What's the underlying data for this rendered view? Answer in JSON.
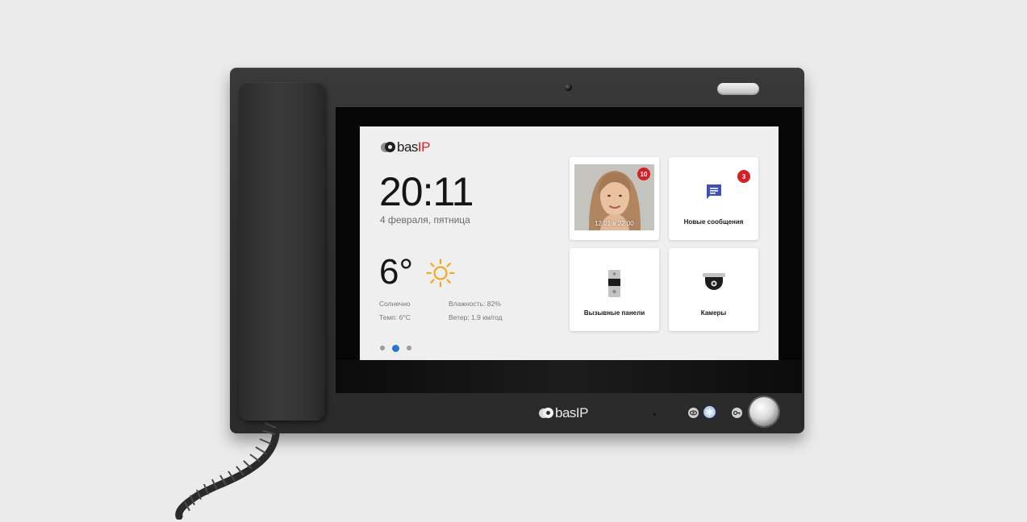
{
  "screen": {
    "logo": {
      "text": "bas",
      "accent": "IP"
    },
    "clock": {
      "time": "20:11",
      "date": "4 февраля, пятница"
    },
    "weather": {
      "temperature": "6°",
      "icon": "sun-icon",
      "condition": "Солнечно",
      "humidity": "Влажность: 82%",
      "temp_detail": "Темп: 6°C",
      "wind": "Ветер: 1,9 км/год"
    },
    "pager": {
      "count": 3,
      "active_index": 1
    },
    "tiles": [
      {
        "id": "visitor-photo",
        "icon": "visitor-photo",
        "badge": "10",
        "timestamp": "12.01 в 22:00"
      },
      {
        "id": "new-messages",
        "icon": "chat-message-icon",
        "badge": "3",
        "label": "Новые сообщения"
      },
      {
        "id": "call-panels",
        "icon": "door-panel-icon",
        "label": "Вызывные панели"
      },
      {
        "id": "cameras",
        "icon": "dome-camera-icon",
        "label": "Камеры"
      }
    ]
  },
  "device": {
    "brand": {
      "text": "bas",
      "accent": "IP"
    },
    "buttons": [
      "eye-icon",
      "snowflake-icon",
      "key-icon",
      "unlock-button"
    ]
  },
  "colors": {
    "accent_red": "#d51f26",
    "accent_blue": "#2777c8",
    "message_blue": "#3f51b5",
    "device_body": "#2e2e2e",
    "background": "#ebebeb"
  }
}
